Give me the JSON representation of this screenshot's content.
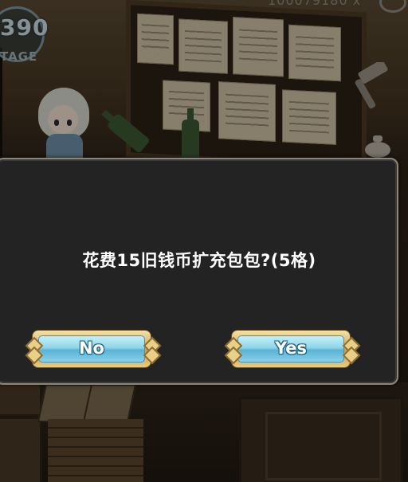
{
  "hud": {
    "stage_number": "390",
    "stage_label": "TAGE",
    "coin_readout": "100079180 x"
  },
  "dialog": {
    "message": "花费15旧钱币扩充包包?(5格)",
    "no_label": "No",
    "yes_label": "Yes"
  },
  "icons": {
    "hammer": "hammer-icon",
    "bag": "money-bag-icon",
    "top_right": "settings-icon"
  },
  "colors": {
    "dialog_bg": "#232323",
    "button_blue": "#8fd5ea",
    "button_gold": "#c99c4c",
    "text": "#ffffff"
  }
}
